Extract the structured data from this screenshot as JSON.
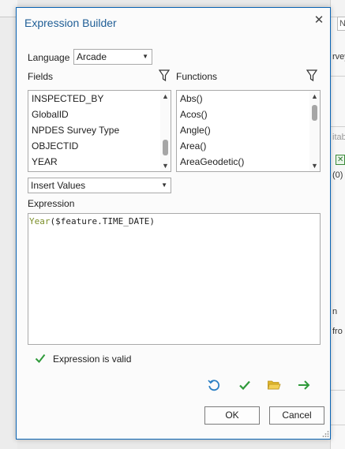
{
  "background": {
    "input_text": "N",
    "right_texts": [
      "rvey",
      "itab",
      "(0)",
      "n",
      "fro"
    ]
  },
  "dialog": {
    "title": "Expression Builder",
    "language_label": "Language",
    "language_value": "Arcade",
    "fields_label": "Fields",
    "functions_label": "Functions",
    "fields": [
      "INSPECTED_BY",
      "GlobalID",
      "NPDES Survey Type",
      "OBJECTID",
      "YEAR"
    ],
    "functions": [
      "Abs()",
      "Acos()",
      "Angle()",
      "Area()",
      "AreaGeodetic()"
    ],
    "insert_values_label": "Insert Values",
    "expression_label": "Expression",
    "expression": {
      "function_name": "Year",
      "open_paren": "(",
      "argument": "$feature.TIME_DATE",
      "close_paren": ")"
    },
    "validation_message": "Expression is valid",
    "ok_label": "OK",
    "cancel_label": "Cancel"
  },
  "colors": {
    "title": "#1f5e96",
    "accent_border": "#0a64b4",
    "valid_green": "#2f9a3a",
    "keyword": "#7c8f2a",
    "folder_yellow": "#e0b72c",
    "undo_blue": "#2b7fc4"
  },
  "icons": {
    "close": "close-icon",
    "filter": "filter-icon",
    "valid": "checkmark-icon",
    "history": "history-icon",
    "verify": "verify-checkmark-icon",
    "open": "folder-open-icon",
    "export": "arrow-right-icon"
  }
}
